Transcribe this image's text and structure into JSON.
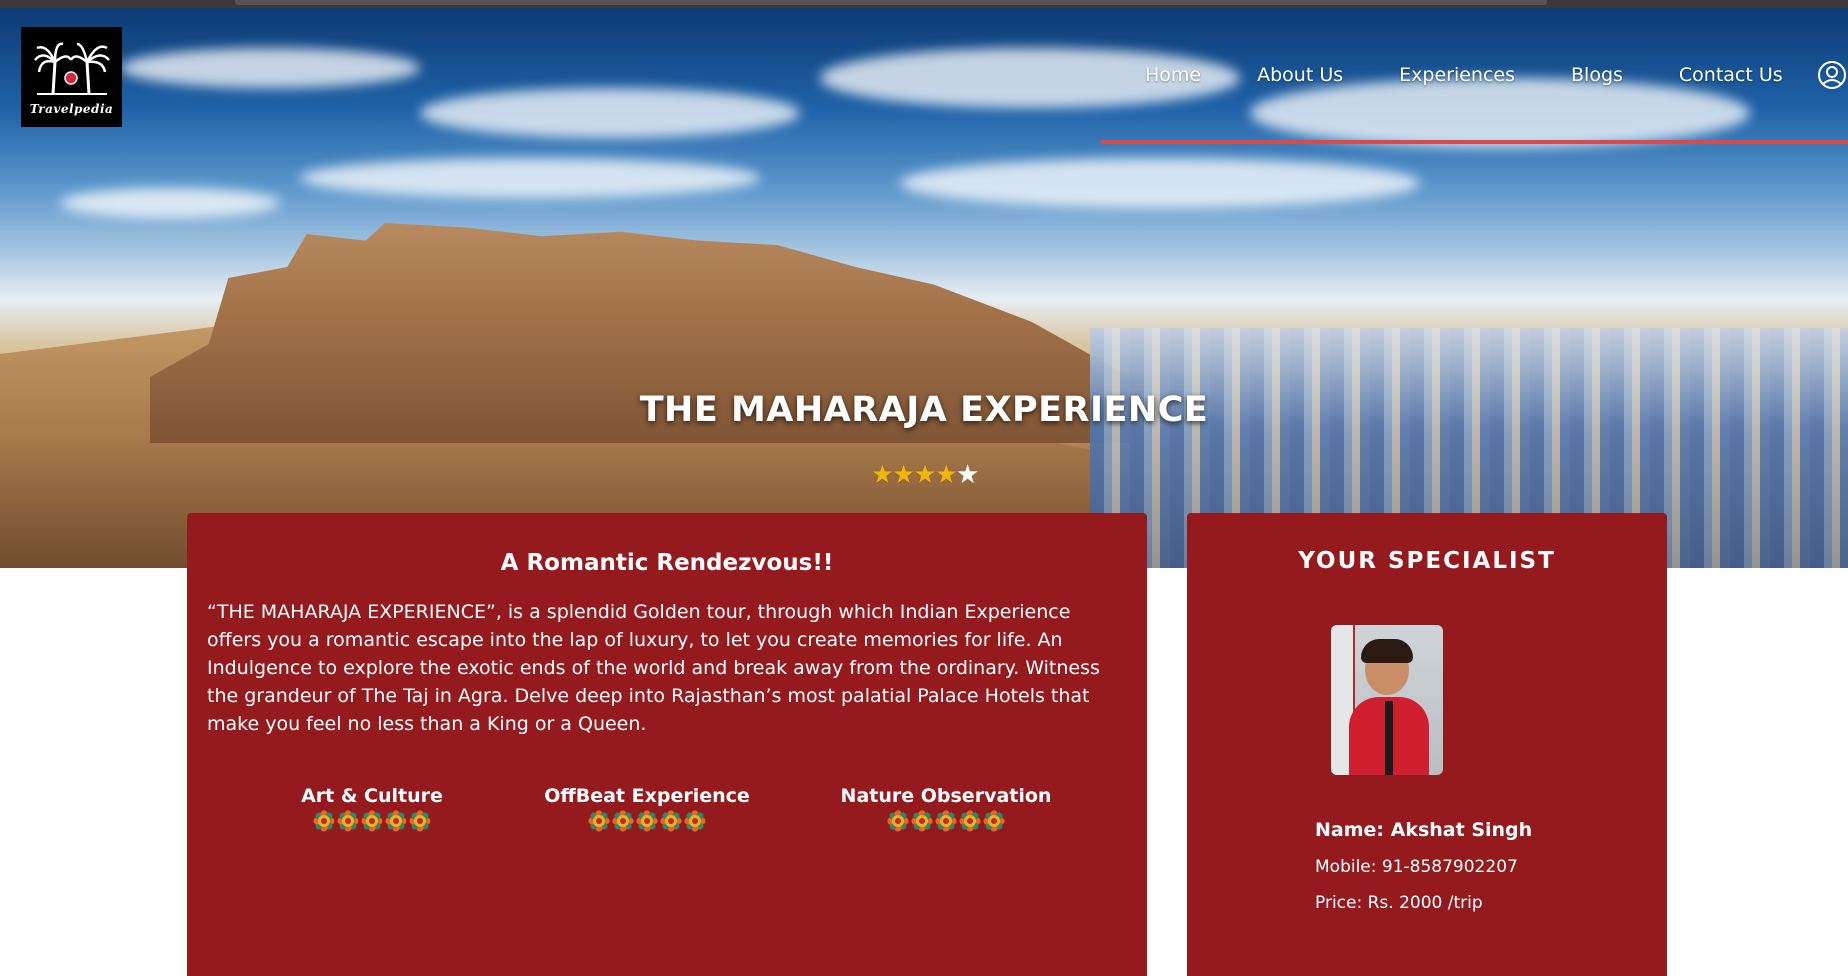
{
  "brand": {
    "name": "Travelpedia"
  },
  "nav": {
    "items": [
      "Home",
      "About Us",
      "Experiences",
      "Blogs",
      "Contact Us"
    ],
    "user_icon": "user-circle-icon",
    "underline_color": "#d94a4a"
  },
  "hero": {
    "title": "THE MAHARAJA EXPERIENCE",
    "rating": {
      "value": 4,
      "max": 5
    }
  },
  "tour": {
    "heading": "A Romantic Rendezvous!!",
    "description": "“THE MAHARAJA EXPERIENCE”, is a splendid Golden tour, through which Indian Experience offers you a romantic escape into the lap of luxury, to let you create memories for life. An Indulgence to explore the exotic ends of the world and break away from the ordinary. Witness the grandeur of The Taj in Agra. Delve deep into Rajasthan’s most palatial Palace Hotels that make you feel no less than a King or a Queen.",
    "features": [
      {
        "label": "Art & Culture",
        "rating": 5
      },
      {
        "label": "OffBeat Experience",
        "rating": 5
      },
      {
        "label": "Nature Observation",
        "rating": 5
      }
    ]
  },
  "specialist": {
    "title": "YOUR SPECIALIST",
    "name": "Name: Akshat Singh",
    "mobile": "Mobile: 91-8587902207",
    "price": "Price: Rs. 2000 /trip"
  },
  "colors": {
    "card_bg": "#951a1d",
    "star": "#f1b60c",
    "page_bg": "#ffffff"
  }
}
